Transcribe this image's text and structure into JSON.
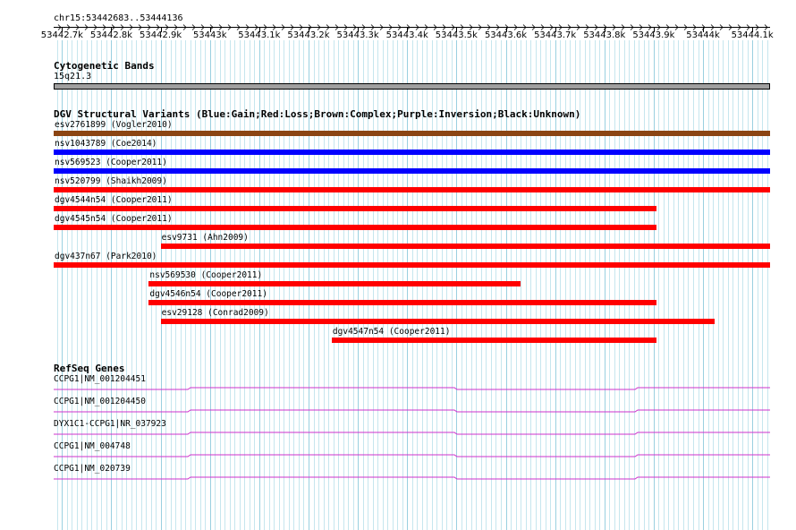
{
  "locus": "chr15:53442683..53444136",
  "ruler": {
    "ticks": [
      "53442.7k",
      "53442.8k",
      "53442.9k",
      "53443k",
      "53443.1k",
      "53443.2k",
      "53443.3k",
      "53443.4k",
      "53443.5k",
      "53443.6k",
      "53443.7k",
      "53443.8k",
      "53443.9k",
      "53444k",
      "53444.1k"
    ],
    "tick_values": [
      53442700,
      53442800,
      53442900,
      53443000,
      53443100,
      53443200,
      53443300,
      53443400,
      53443500,
      53443600,
      53443700,
      53443800,
      53443900,
      53444000,
      53444100
    ],
    "start": 53442683,
    "end": 53444136
  },
  "tracks": {
    "cytoband": {
      "title": "Cytogenetic Bands",
      "band": "15q21.3",
      "color": "#a0a0a0"
    },
    "dgv": {
      "title": "DGV Structural Variants (Blue:Gain;Red:Loss;Brown:Complex;Purple:Inversion;Black:Unknown)",
      "colors": {
        "gain": "#0000ff",
        "loss": "#ff0000",
        "complex": "#8b4513"
      },
      "features": [
        {
          "label": "esv2761899 (Vogler2010)",
          "type": "complex",
          "start": 53442683,
          "end": 53444136
        },
        {
          "label": "nsv1043789 (Coe2014)",
          "type": "gain",
          "start": 53442683,
          "end": 53444136
        },
        {
          "label": "nsv569523 (Cooper2011)",
          "type": "gain",
          "start": 53442683,
          "end": 53444136
        },
        {
          "label": "nsv520799 (Shaikh2009)",
          "type": "loss",
          "start": 53442683,
          "end": 53444136
        },
        {
          "label": "dgv4544n54 (Cooper2011)",
          "type": "loss",
          "start": 53442683,
          "end": 53443906
        },
        {
          "label": "dgv4545n54 (Cooper2011)",
          "type": "loss",
          "start": 53442683,
          "end": 53443906
        },
        {
          "label": "esv9731 (Ahn2009)",
          "type": "loss",
          "start": 53442900,
          "end": 53444136
        },
        {
          "label": "dgv437n67 (Park2010)",
          "type": "loss",
          "start": 53442683,
          "end": 53444136
        },
        {
          "label": "nsv569530 (Cooper2011)",
          "type": "loss",
          "start": 53442876,
          "end": 53443630
        },
        {
          "label": "dgv4546n54 (Cooper2011)",
          "type": "loss",
          "start": 53442876,
          "end": 53443906
        },
        {
          "label": "esv29128 (Conrad2009)",
          "type": "loss",
          "start": 53442900,
          "end": 53444024
        },
        {
          "label": "dgv4547n54 (Cooper2011)",
          "type": "loss",
          "start": 53443247,
          "end": 53443906
        }
      ]
    },
    "refseq": {
      "title": "RefSeq Genes",
      "color": "#cc33cc",
      "genes": [
        {
          "label": "CCPG1|NM_001204451"
        },
        {
          "label": "CCPG1|NM_001204450"
        },
        {
          "label": "DYX1C1-CCPG1|NR_037923"
        },
        {
          "label": "CCPG1|NM_004748"
        },
        {
          "label": "CCPG1|NM_020739"
        }
      ]
    }
  }
}
